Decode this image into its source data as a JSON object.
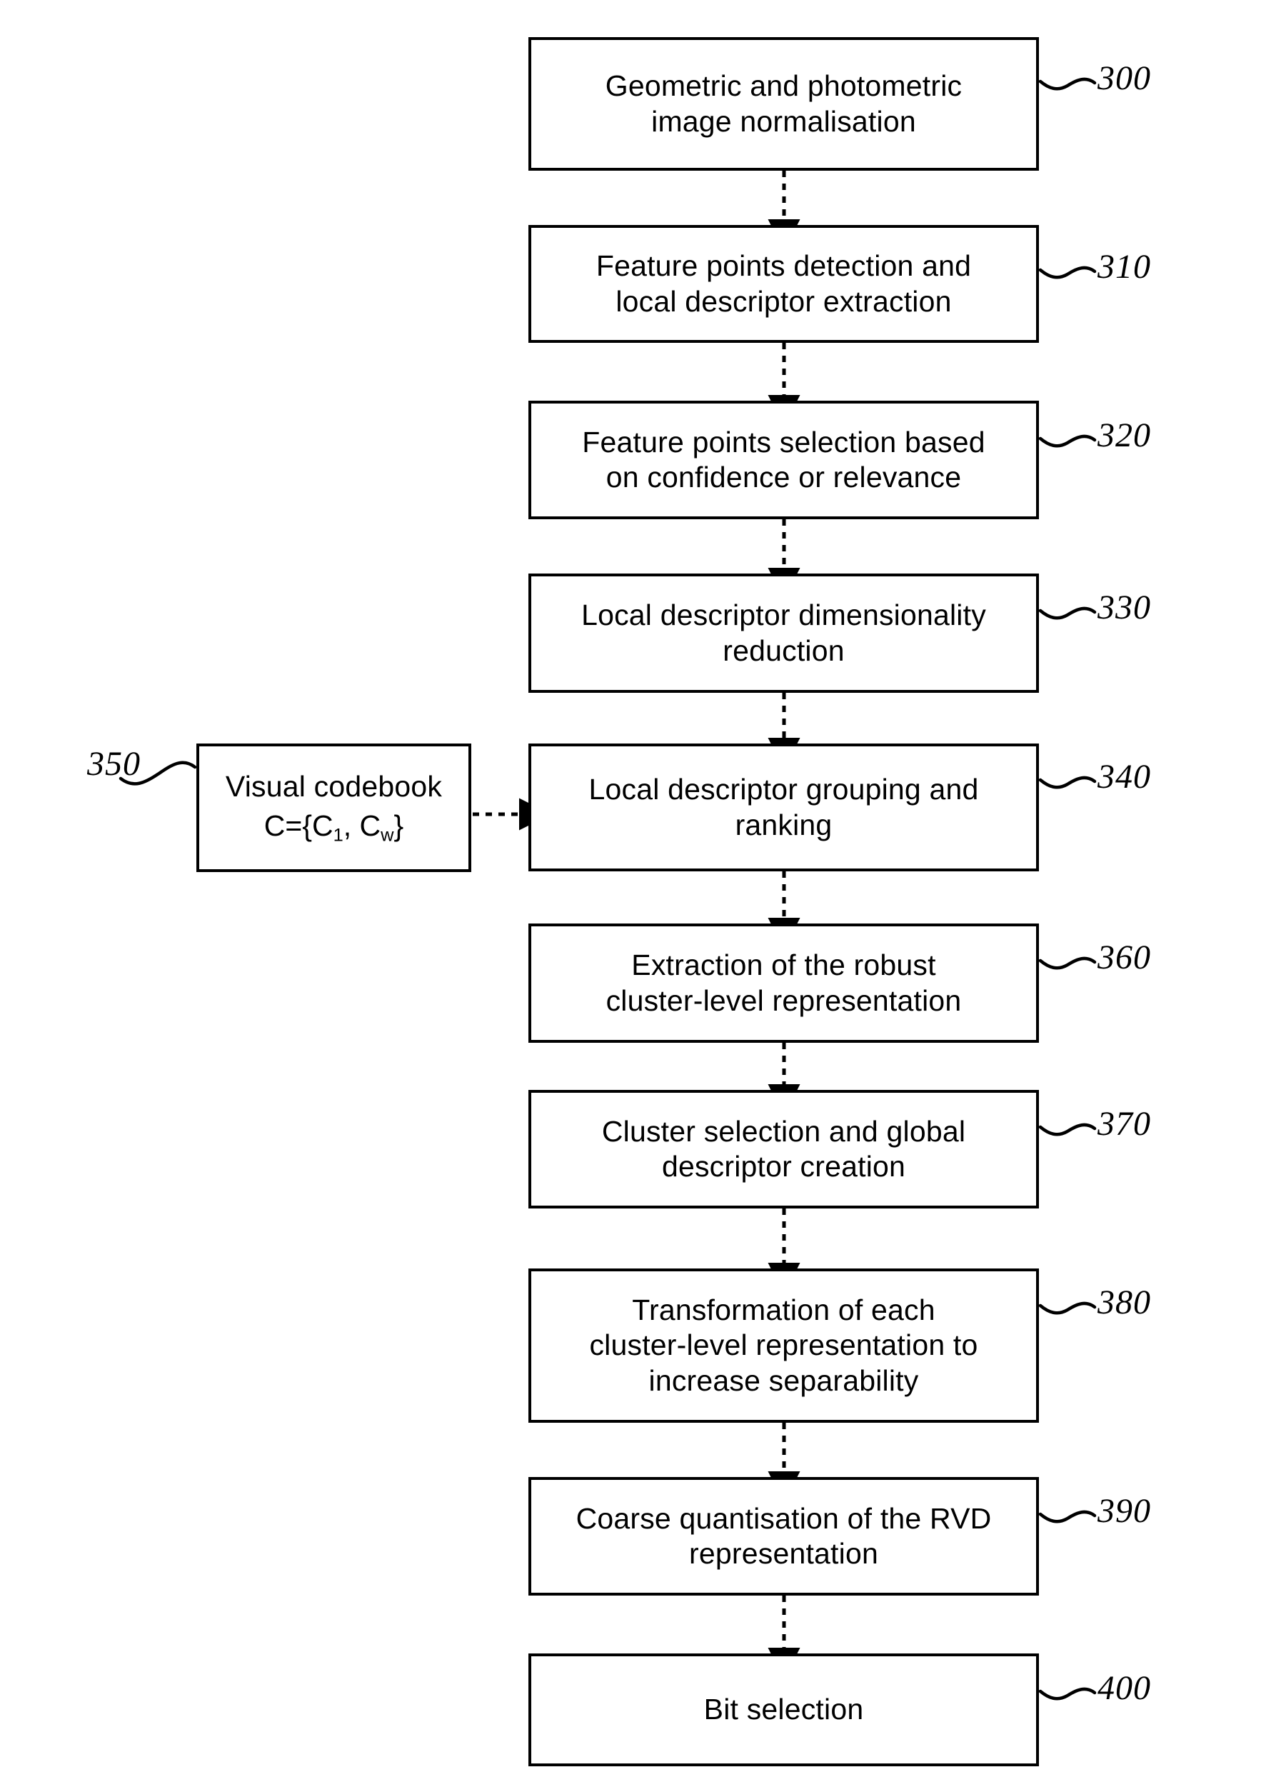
{
  "figure": {
    "type": "patent-flowchart",
    "orientation": "vertical",
    "background_color": "#ffffff",
    "line_color": "#000000"
  },
  "nodes": [
    {
      "id": "300",
      "ref": "300",
      "label": "Geometric and photometric\nimage normalisation"
    },
    {
      "id": "310",
      "ref": "310",
      "label": "Feature points detection and\nlocal descriptor extraction"
    },
    {
      "id": "320",
      "ref": "320",
      "label": "Feature points selection based\non confidence or relevance"
    },
    {
      "id": "330",
      "ref": "330",
      "label": "Local descriptor dimensionality\nreduction"
    },
    {
      "id": "340",
      "ref": "340",
      "label": "Local descriptor grouping and\nranking"
    },
    {
      "id": "360",
      "ref": "360",
      "label": "Extraction of the robust\ncluster-level representation"
    },
    {
      "id": "370",
      "ref": "370",
      "label": "Cluster selection and global\ndescriptor creation"
    },
    {
      "id": "380",
      "ref": "380",
      "label": "Transformation of each\ncluster-level representation to\nincrease separability"
    },
    {
      "id": "390",
      "ref": "390",
      "label": "Coarse quantisation of the RVD\nrepresentation"
    },
    {
      "id": "400",
      "ref": "400",
      "label": "Bit selection"
    }
  ],
  "codebook": {
    "ref": "350",
    "title": "Visual codebook",
    "formula_prefix": "C={C",
    "formula_sub1": "1",
    "formula_middle": ", C",
    "formula_sub2": "w",
    "formula_suffix": "}"
  },
  "connectors": {
    "vertical_arrow_count": 9,
    "horizontal_arrow_count": 1,
    "style": "dashed-with-solid-arrowhead"
  }
}
